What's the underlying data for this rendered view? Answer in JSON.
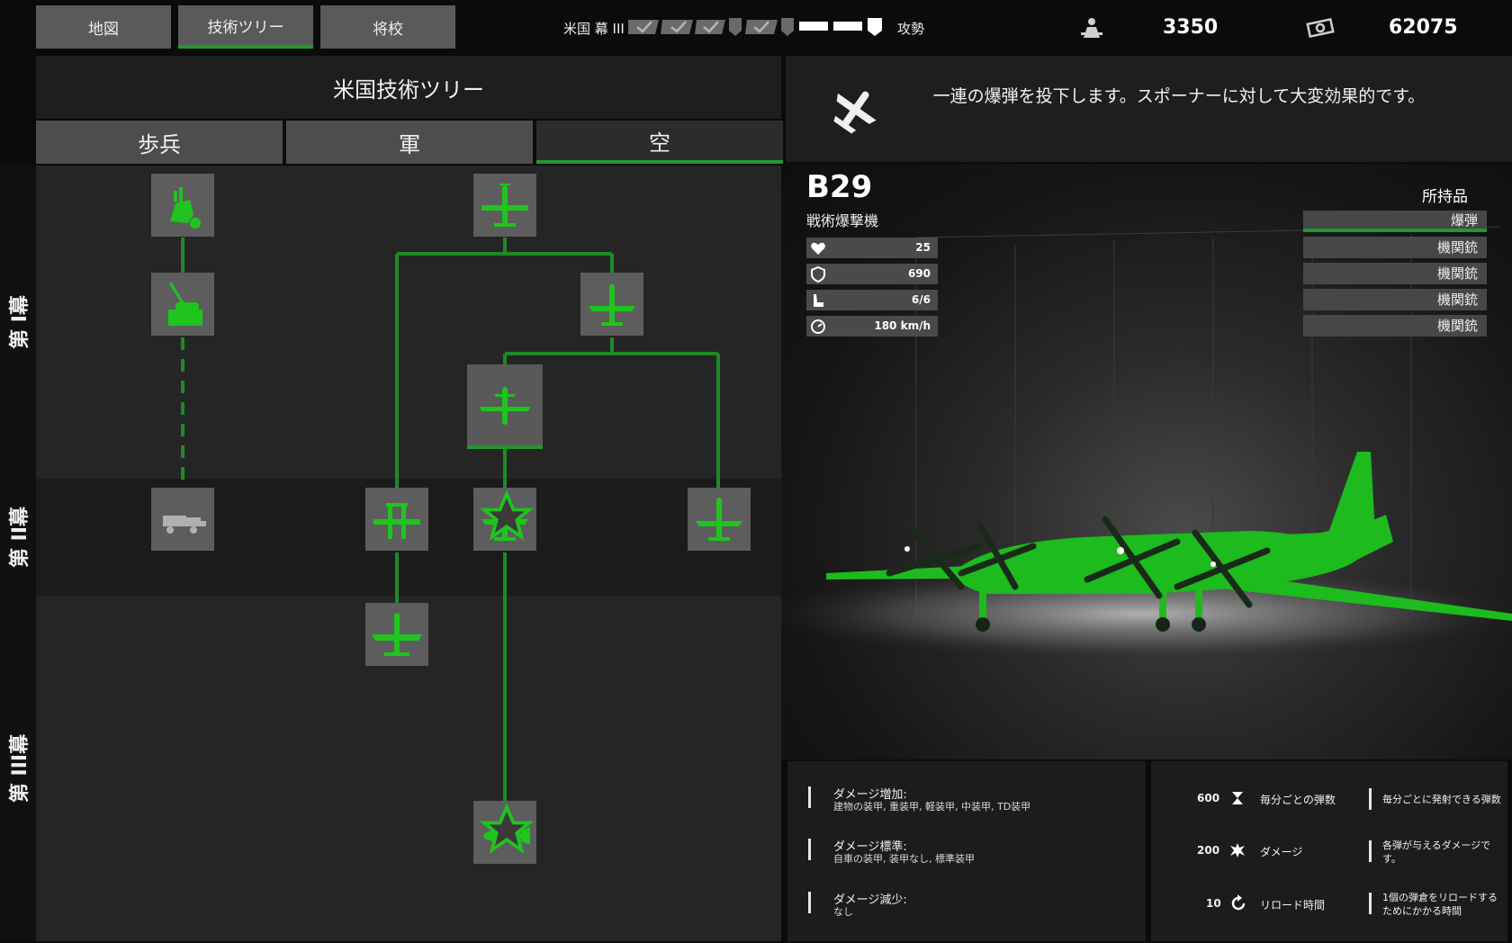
{
  "top_tabs": [
    {
      "label": "地図"
    },
    {
      "label": "技術ツリー"
    },
    {
      "label": "将校"
    }
  ],
  "progress": {
    "faction_label": "米国 幕 III",
    "right_label": "攻勢"
  },
  "resources": {
    "manpower_value": "3350",
    "money_value": "62075"
  },
  "tree": {
    "title": "米国技術ツリー",
    "categories": [
      {
        "label": "歩兵"
      },
      {
        "label": "軍"
      },
      {
        "label": "空"
      }
    ],
    "eras": [
      {
        "label": "第 I幕"
      },
      {
        "label": "第 II幕"
      },
      {
        "label": "第 III幕"
      }
    ]
  },
  "detail": {
    "description": "一連の爆弾を投下します。スポーナーに対して大変効果的です。",
    "name": "B29",
    "type": "戦術爆撃機",
    "stats": {
      "health": "25",
      "armor": "690",
      "seats": "6/6",
      "speed": "180 km/h"
    },
    "inventory_label": "所持品",
    "weapons": [
      {
        "label": "爆弾"
      },
      {
        "label": "機関銃"
      },
      {
        "label": "機関銃"
      },
      {
        "label": "機関銃"
      },
      {
        "label": "機関銃"
      }
    ]
  },
  "damage_info": {
    "increase_title": "ダメージ増加:",
    "increase_text": "建物の装甲, 重装甲, 軽装甲, 中装甲, TD装甲",
    "standard_title": "ダメージ標準:",
    "standard_text": "自車の装甲, 装甲なし, 標準装甲",
    "decrease_title": "ダメージ減少:",
    "decrease_text": "なし"
  },
  "weapon_stats": [
    {
      "value": "600",
      "label": "毎分ごとの弾数",
      "desc": "毎分ごとに発射できる弾数"
    },
    {
      "value": "200",
      "label": "ダメージ",
      "desc": "各弾が与えるダメージです。"
    },
    {
      "value": "10",
      "label": "リロード時間",
      "desc": "1個の弾倉をリロードするためにかかる時間"
    }
  ],
  "colors": {
    "accent": "#1f9a2d",
    "unit_green": "#1fc41f"
  }
}
